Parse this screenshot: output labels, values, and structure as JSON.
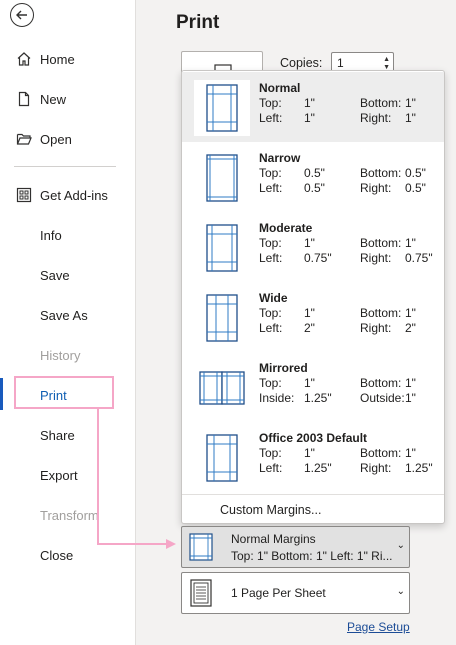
{
  "nav": {
    "back_icon": "back-arrow-icon",
    "items": [
      {
        "label": "Home",
        "icon": "home-icon"
      },
      {
        "label": "New",
        "icon": "new-document-icon"
      },
      {
        "label": "Open",
        "icon": "open-folder-icon"
      },
      {
        "label": "Get Add-ins",
        "icon": "add-ins-grid-icon"
      },
      {
        "label": "Info"
      },
      {
        "label": "Save"
      },
      {
        "label": "Save As"
      },
      {
        "label": "History",
        "state": "disabled"
      },
      {
        "label": "Print",
        "state": "active"
      },
      {
        "label": "Share"
      },
      {
        "label": "Export"
      },
      {
        "label": "Transform",
        "state": "disabled"
      },
      {
        "label": "Close"
      }
    ]
  },
  "page": {
    "title": "Print"
  },
  "copies": {
    "label": "Copies:",
    "value": "1"
  },
  "margins_menu": {
    "options": [
      {
        "name": "Normal",
        "selected": true,
        "rows": [
          [
            "Top:",
            "1\"",
            "Bottom:",
            "1\""
          ],
          [
            "Left:",
            "1\"",
            "Right:",
            "1\""
          ]
        ]
      },
      {
        "name": "Narrow",
        "rows": [
          [
            "Top:",
            "0.5\"",
            "Bottom:",
            "0.5\""
          ],
          [
            "Left:",
            "0.5\"",
            "Right:",
            "0.5\""
          ]
        ]
      },
      {
        "name": "Moderate",
        "rows": [
          [
            "Top:",
            "1\"",
            "Bottom:",
            "1\""
          ],
          [
            "Left:",
            "0.75\"",
            "Right:",
            "0.75\""
          ]
        ]
      },
      {
        "name": "Wide",
        "rows": [
          [
            "Top:",
            "1\"",
            "Bottom:",
            "1\""
          ],
          [
            "Left:",
            "2\"",
            "Right:",
            "2\""
          ]
        ]
      },
      {
        "name": "Mirrored",
        "rows": [
          [
            "Top:",
            "1\"",
            "Bottom:",
            "1\""
          ],
          [
            "Inside:",
            "1.25\"",
            "Outside:",
            "1\""
          ]
        ]
      },
      {
        "name": "Office 2003 Default",
        "rows": [
          [
            "Top:",
            "1\"",
            "Bottom:",
            "1\""
          ],
          [
            "Left:",
            "1.25\"",
            "Right:",
            "1.25\""
          ]
        ]
      }
    ],
    "custom_label": "Custom Margins..."
  },
  "margins_setting": {
    "title": "Normal Margins",
    "detail": "Top: 1\" Bottom: 1\" Left: 1\" Ri...",
    "icon": "page-margins-icon"
  },
  "pages_per_sheet": {
    "value": "1 Page Per Sheet",
    "icon": "single-page-icon"
  },
  "page_setup_link": "Page Setup",
  "colors": {
    "accent": "#185abd",
    "active_text": "#0f5fb3",
    "annotation": "#f5a6c7"
  }
}
